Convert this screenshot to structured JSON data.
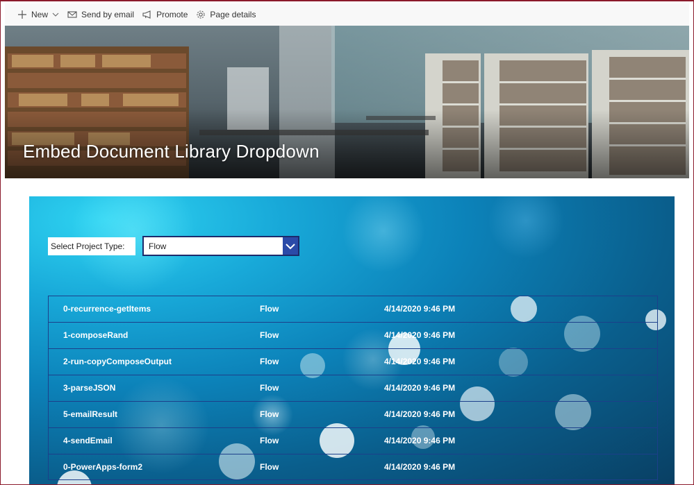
{
  "toolbar": {
    "new_label": "New",
    "send_label": "Send by email",
    "promote_label": "Promote",
    "details_label": "Page details"
  },
  "banner": {
    "title": "Embed Document Library Dropdown"
  },
  "filter": {
    "label": "Select Project Type:",
    "selected": "Flow"
  },
  "items": [
    {
      "name": "0-recurrence-getItems",
      "type": "Flow",
      "modified": "4/14/2020 9:46 PM"
    },
    {
      "name": "1-composeRand",
      "type": "Flow",
      "modified": "4/14/2020 9:46 PM"
    },
    {
      "name": "2-run-copyComposeOutput",
      "type": "Flow",
      "modified": "4/14/2020 9:46 PM"
    },
    {
      "name": "3-parseJSON",
      "type": "Flow",
      "modified": "4/14/2020 9:46 PM"
    },
    {
      "name": "5-emailResult",
      "type": "Flow",
      "modified": "4/14/2020 9:46 PM"
    },
    {
      "name": "4-sendEmail",
      "type": "Flow",
      "modified": "4/14/2020 9:46 PM"
    },
    {
      "name": "0-PowerApps-form2",
      "type": "Flow",
      "modified": "4/14/2020 9:46 PM"
    }
  ],
  "colors": {
    "frame": "#8b1a2b",
    "dropdown_button": "#2b4aa8",
    "row_border": "#1c3f8a"
  }
}
